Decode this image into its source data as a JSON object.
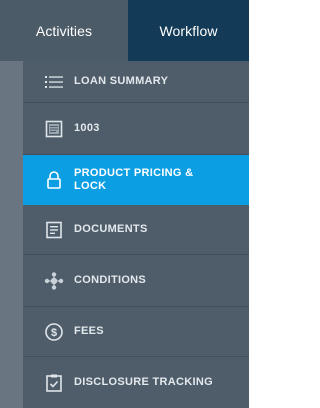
{
  "tabs": {
    "activities": "Activities",
    "workflow": "Workflow"
  },
  "menu": {
    "items": [
      {
        "label": "LOAN SUMMARY",
        "icon": "list-icon"
      },
      {
        "label": "1003",
        "icon": "form-icon"
      },
      {
        "label": "PRODUCT PRICING & LOCK",
        "icon": "lock-icon"
      },
      {
        "label": "DOCUMENTS",
        "icon": "document-icon"
      },
      {
        "label": "CONDITIONS",
        "icon": "conditions-icon"
      },
      {
        "label": "FEES",
        "icon": "dollar-circle-icon"
      },
      {
        "label": "DISCLOSURE TRACKING",
        "icon": "clipboard-check-icon"
      }
    ],
    "active_index": 2
  },
  "colors": {
    "active": "#0c9ee2",
    "tab_selected": "#133a57",
    "menu_bg": "#4f5d6a"
  }
}
